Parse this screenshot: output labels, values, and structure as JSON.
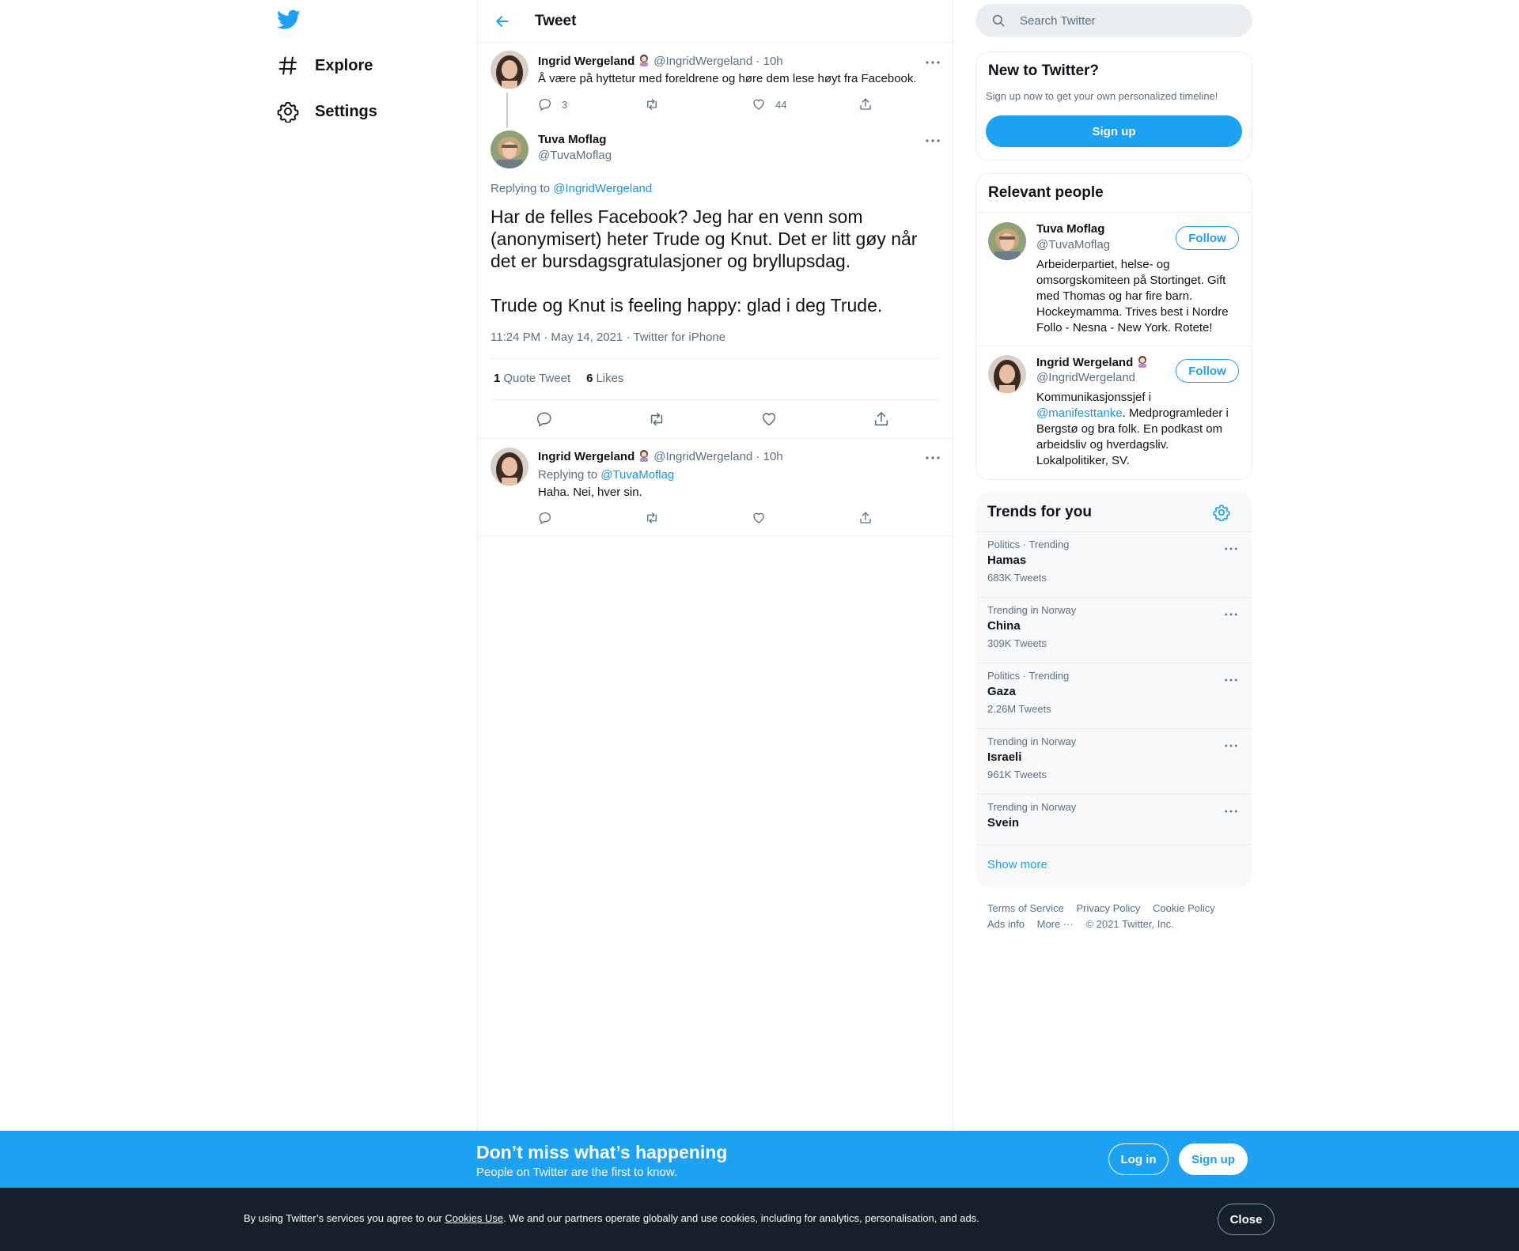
{
  "nav": {
    "items": [
      {
        "label": "Explore",
        "icon": "hashtag-icon"
      },
      {
        "label": "Settings",
        "icon": "gear-icon"
      }
    ]
  },
  "header": {
    "title": "Tweet"
  },
  "tweets": {
    "parent": {
      "name": "Ingrid Wergeland",
      "handle": "@IngridWergeland",
      "time": "· 10h",
      "text": "Å være på hyttetur med foreldrene og høre dem lese høyt fra Facebook.",
      "replies": "3",
      "likes": "44"
    },
    "focal": {
      "name": "Tuva Moflag",
      "handle": "@TuvaMoflag",
      "replying_prefix": "Replying to",
      "replying_to": "@IngridWergeland",
      "para1": "Har de felles Facebook? Jeg har en venn som (anonymisert) heter Trude og Knut. Det er litt gøy når det er bursdagsgratulasjoner og bryllupsdag.",
      "para2": "Trude og Knut is feeling happy: glad i deg Trude.",
      "meta": "11:24 PM · May 14, 2021 · Twitter for iPhone",
      "quote_count": "1",
      "quote_label": "Quote Tweet",
      "like_count": "6",
      "like_label": "Likes"
    },
    "reply": {
      "name": "Ingrid Wergeland",
      "handle": "@IngridWergeland",
      "time": "· 10h",
      "replying_prefix": "Replying to",
      "replying_to": "@TuvaMoflag",
      "text": "Haha. Nei, hver sin."
    }
  },
  "search": {
    "placeholder": "Search Twitter"
  },
  "new_to_twitter": {
    "title": "New to Twitter?",
    "subtitle": "Sign up now to get your own personalized timeline!",
    "button": "Sign up"
  },
  "relevant_people": {
    "title": "Relevant people",
    "people": [
      {
        "name": "Tuva Moflag",
        "handle": "@TuvaMoflag",
        "follow": "Follow",
        "bio": "Arbeiderpartiet, helse- og omsorgskomiteen på Stortinget. Gift med Thomas og har fire barn. Hockeymamma. Trives best i Nordre Follo - Nesna - New York. Rotete!"
      },
      {
        "name": "Ingrid Wergeland",
        "handle": "@IngridWergeland",
        "follow": "Follow",
        "bio_prefix": "Kommunikasjonssjef i",
        "bio_link": "@manifesttanke",
        "bio_suffix": ". Medprogramleder i Bergstø og bra folk. En podkast om arbeidsliv og hverdagsliv. Lokalpolitiker, SV."
      }
    ]
  },
  "trends": {
    "title": "Trends for you",
    "items": [
      {
        "category": "Politics · Trending",
        "name": "Hamas",
        "count": "683K Tweets"
      },
      {
        "category": "Trending in Norway",
        "name": "China",
        "count": "309K Tweets"
      },
      {
        "category": "Politics · Trending",
        "name": "Gaza",
        "count": "2.26M Tweets"
      },
      {
        "category": "Trending in Norway",
        "name": "Israeli",
        "count": "961K Tweets"
      },
      {
        "category": "Trending in Norway",
        "name": "Svein",
        "count": ""
      }
    ],
    "show_more": "Show more"
  },
  "footer": {
    "links": [
      "Terms of Service",
      "Privacy Policy",
      "Cookie Policy",
      "Ads info",
      "More ···"
    ],
    "copyright": "© 2021 Twitter, Inc."
  },
  "bottom_bar": {
    "title": "Don’t miss what’s happening",
    "subtitle": "People on Twitter are the first to know.",
    "login": "Log in",
    "signup": "Sign up"
  },
  "cookie": {
    "prefix": "By using Twitter’s services you agree to our",
    "link": "Cookies Use",
    "suffix": ". We and our partners operate globally and use cookies, including for analytics, personalisation, and ads.",
    "close": "Close"
  },
  "colors": {
    "accent": "#1da1f2",
    "link": "#1b95e0",
    "muted": "#5b7083",
    "cookie_bg": "#15202b"
  }
}
